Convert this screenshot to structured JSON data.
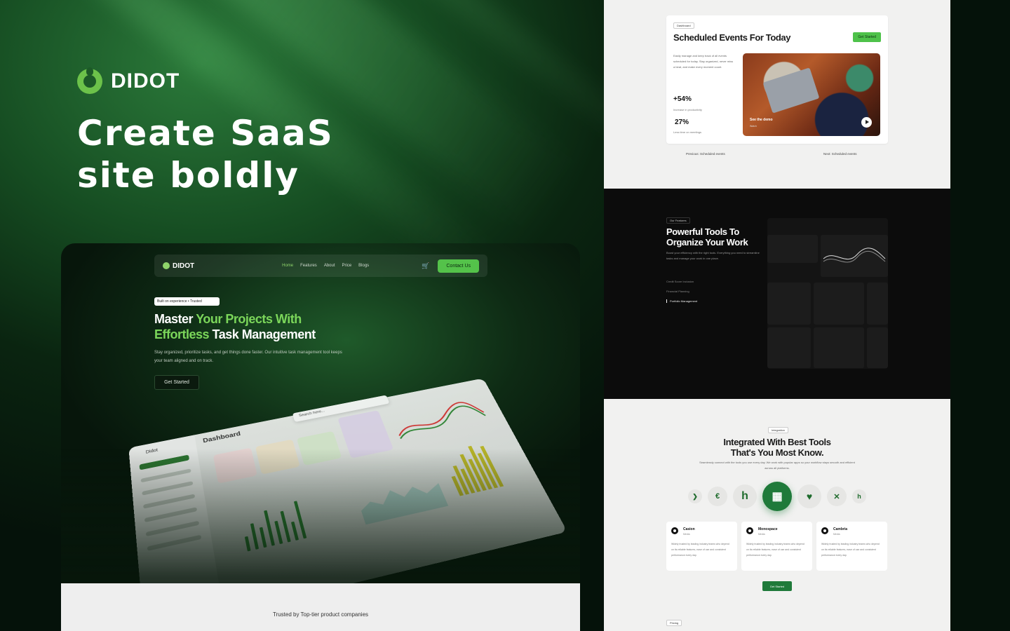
{
  "brand": {
    "name": "DIDOT"
  },
  "headline": {
    "line1": "Create SaaS",
    "line2": "site boldly"
  },
  "preview": {
    "nav": {
      "logo": "DIDOT",
      "links": [
        "Home",
        "Features",
        "About",
        "Price",
        "Blogs"
      ],
      "contact": "Contact Us"
    },
    "badge": "Built on experience • Trusted",
    "title_part1": "Master ",
    "title_green1": "Your Projects With",
    "title_green2": "Effortless",
    "title_part2": " Task Management",
    "subtitle": "Stay organized, prioritize tasks, and get things done faster. Our intuitive task management tool keeps your team aligned and on track.",
    "cta": "Get Started",
    "dashboard": {
      "title": "Dashboard",
      "brand": "Didot",
      "search": "Search here...",
      "sidebar_active": "Dashboard"
    },
    "trusted": "Trusted by Top-tier product companies"
  },
  "events": {
    "tag": "Dashboard",
    "title": "Scheduled Events For Today",
    "button": "Get Started",
    "description": "Easily manage and keep track of all events scheduled for today. Stay organized, never miss a beat, and make every moment count.",
    "stat1": "+54%",
    "stat1_label": "Increase in productivity",
    "stat2": "27%",
    "stat2_label": "Less time on meetings",
    "demo": "See the demo",
    "demo_sub": "Watch",
    "prev": "Previous: Scheduled events",
    "next": "Next: Scheduled events"
  },
  "tools": {
    "tag": "Our Features",
    "title": "Powerful Tools To Organize Your Work",
    "description": "Boost your efficiency with the right tools. Everything you need to streamline tasks and manage your work in one place.",
    "menu": [
      "Credit Score Inclusion",
      "Financial Planning",
      "Portfolio Management"
    ]
  },
  "integrations": {
    "tag": "Integration",
    "title1": "Integrated With Best Tools",
    "title2": "That's You Most Know.",
    "description": "Seamlessly connect with the tools you use every day. We work with popular apps so your workflow stays smooth and efficient across all platforms.",
    "cards": [
      {
        "name": "Casion",
        "sub": "Media",
        "desc": "Widely trusted by leading industry teams who depend on its reliable features, ease of use and consistent performance every day."
      },
      {
        "name": "Monospace",
        "sub": "Media",
        "desc": "Widely trusted by leading industry teams who depend on its reliable features, ease of use and consistent performance every day."
      },
      {
        "name": "Cambria",
        "sub": "Media",
        "desc": "Widely trusted by leading industry teams who depend on its reliable features, ease of use and consistent performance every day."
      }
    ],
    "button": "Get Started",
    "footer_tag": "Pricing"
  },
  "colors": {
    "accent": "#54c24a",
    "brand_green": "#1f7a3a",
    "dark_bg": "#05120a"
  }
}
